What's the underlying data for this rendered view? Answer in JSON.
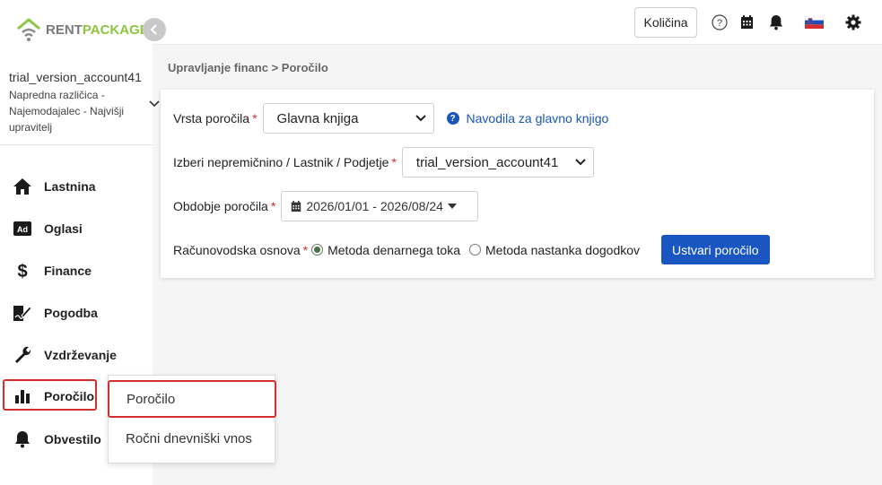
{
  "brand": {
    "part1": "RENT",
    "part2": "PACKAGE"
  },
  "account": {
    "name": "trial_version_account41",
    "description": "Napredna različica - Najemodajalec - Najvišji upravitelj"
  },
  "sidebar": {
    "items": [
      {
        "label": "Lastnina",
        "icon": "home-icon"
      },
      {
        "label": "Oglasi",
        "icon": "ad-icon"
      },
      {
        "label": "Finance",
        "icon": "dollar-icon"
      },
      {
        "label": "Pogodba",
        "icon": "contract-icon"
      },
      {
        "label": "Vzdrževanje",
        "icon": "wrench-icon"
      },
      {
        "label": "Poročilo",
        "icon": "bar-chart-icon"
      },
      {
        "label": "Obvestilo",
        "icon": "bell-icon"
      }
    ]
  },
  "flyout": {
    "items": [
      {
        "label": "Poročilo"
      },
      {
        "label": "Ročni dnevniški vnos"
      }
    ]
  },
  "topbar": {
    "quantity_label": "Količina",
    "icons": [
      "help-icon",
      "calendar-icon",
      "bell-icon",
      "flag-si-icon",
      "gear-icon"
    ]
  },
  "breadcrumb": "Upravljanje financ > Poročilo",
  "form": {
    "report_type": {
      "label": "Vrsta poročila",
      "required": "*",
      "value": "Glavna knjiga",
      "help_text": "Navodila za glavno knjigo"
    },
    "property": {
      "label": "Izberi nepremičnino / Lastnik / Podjetje",
      "required": "*",
      "value": "trial_version_account41"
    },
    "period": {
      "label": "Obdobje poročila",
      "required": "*",
      "value": "2026/01/01 - 2026/08/24"
    },
    "accounting_basis": {
      "label": "Računovodska osnova",
      "required": "*",
      "options": [
        {
          "label": "Metoda denarnega toka",
          "checked": true
        },
        {
          "label": "Metoda nastanka dogodkov",
          "checked": false
        }
      ]
    },
    "submit_label": "Ustvari poročilo"
  },
  "colors": {
    "accent": "#1a56c2",
    "brand_green": "#8dc63f",
    "highlight_red": "#d32f2f"
  }
}
